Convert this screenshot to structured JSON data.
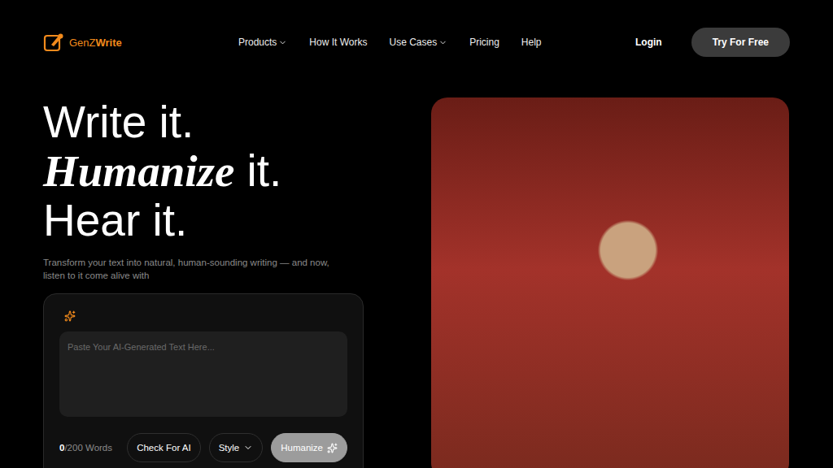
{
  "brand": {
    "name_accent": "GenZ",
    "name_rest": "Write"
  },
  "nav": [
    {
      "label": "Products",
      "kind": "menu"
    },
    {
      "label": "How It Works",
      "kind": "link"
    },
    {
      "label": "Use Cases",
      "kind": "menu"
    },
    {
      "label": "Pricing",
      "kind": "link"
    },
    {
      "label": "Help",
      "kind": "link"
    }
  ],
  "login": "Login",
  "cta": "Try For Free",
  "hero": {
    "lines": [
      [
        {
          "text": "Write it.",
          "kind": "plain"
        }
      ],
      [
        {
          "text": "Humanize",
          "kind": "serif"
        },
        {
          "text": " it.",
          "kind": "plain"
        }
      ],
      [
        {
          "text": "Hear it.",
          "kind": "plain"
        }
      ]
    ],
    "subtitle": "Transform your text into natural, human-sounding writing — and now, listen to it come alive with"
  },
  "editor": {
    "placeholder": "Paste Your AI-Generated Text Here...",
    "count": "0",
    "limit": "/200 Words",
    "check_button": "Check For AI",
    "style_select": "Style",
    "humanize_button": "Humanize"
  }
}
